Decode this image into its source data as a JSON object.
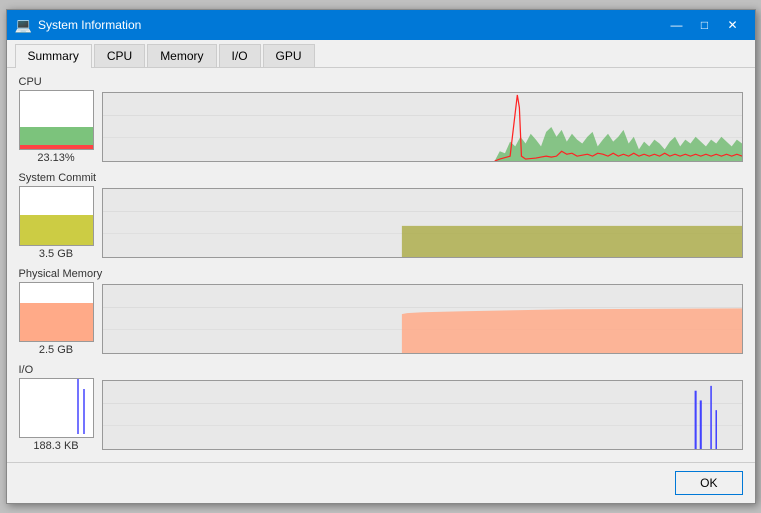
{
  "window": {
    "title": "System Information",
    "icon": "💻"
  },
  "title_controls": {
    "minimize": "—",
    "maximize": "□",
    "close": "✕"
  },
  "tabs": [
    {
      "id": "summary",
      "label": "Summary",
      "active": true
    },
    {
      "id": "cpu",
      "label": "CPU",
      "active": false
    },
    {
      "id": "memory",
      "label": "Memory",
      "active": false
    },
    {
      "id": "io",
      "label": "I/O",
      "active": false
    },
    {
      "id": "gpu",
      "label": "GPU",
      "active": false
    }
  ],
  "metrics": {
    "cpu": {
      "label": "CPU",
      "value": "23.13%"
    },
    "system_commit": {
      "label": "System Commit",
      "value": "3.5 GB"
    },
    "physical_memory": {
      "label": "Physical Memory",
      "value": "2.5 GB"
    },
    "io": {
      "label": "I/O",
      "value": "188.3  KB"
    }
  },
  "footer": {
    "ok_label": "OK"
  }
}
